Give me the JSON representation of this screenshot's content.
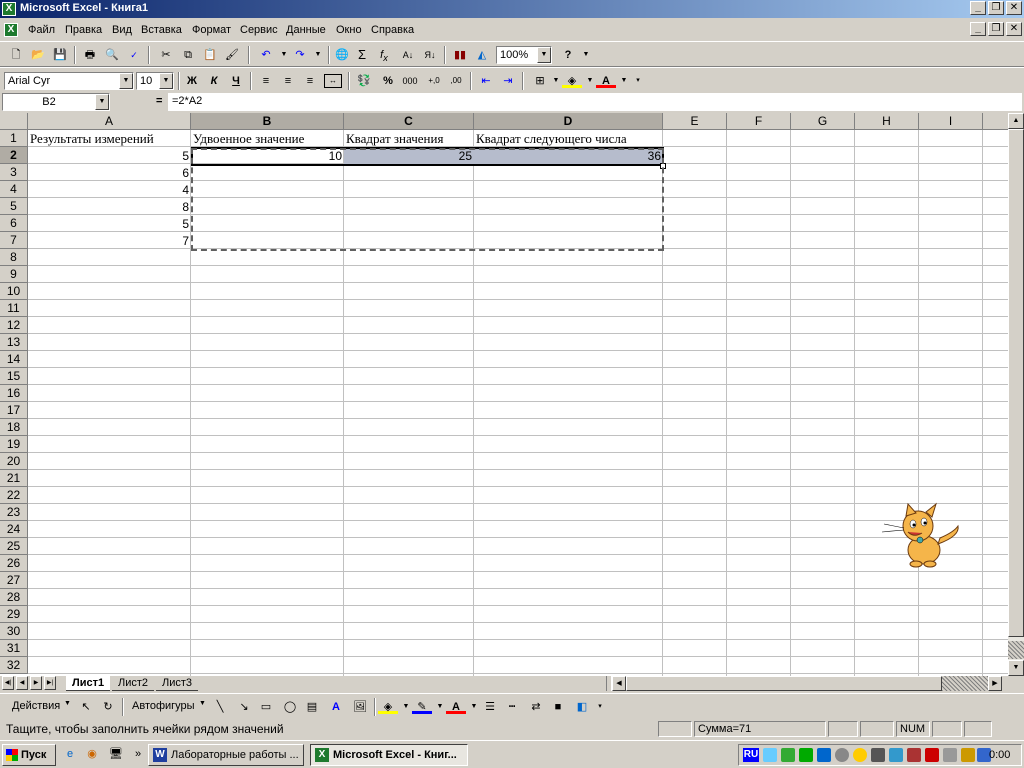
{
  "window": {
    "title": "Microsoft Excel - Книга1"
  },
  "menu": [
    "Файл",
    "Правка",
    "Вид",
    "Вставка",
    "Формат",
    "Сервис",
    "Данные",
    "Окно",
    "Справка"
  ],
  "toolbar": {
    "zoom": "100%",
    "font": "Arial Cyr",
    "size": "10"
  },
  "formula_bar": {
    "name_box": "B2",
    "equals": "=",
    "formula": "=2*A2"
  },
  "columns": [
    "A",
    "B",
    "C",
    "D",
    "E",
    "F",
    "G",
    "H",
    "I"
  ],
  "rows": [
    "1",
    "2",
    "3",
    "4",
    "5",
    "6",
    "7",
    "8",
    "9",
    "10",
    "11",
    "12",
    "13",
    "14",
    "15",
    "16",
    "17",
    "18",
    "19",
    "20",
    "21",
    "22",
    "23",
    "24",
    "25",
    "26",
    "27",
    "28",
    "29",
    "30",
    "31",
    "32"
  ],
  "cells": {
    "A1": "Результаты измерений",
    "B1": "Удвоенное значение",
    "C1": "Квадрат значения",
    "D1": "Квадрат следующего числа",
    "A2": "5",
    "A3": "6",
    "A4": "4",
    "A5": "8",
    "A6": "5",
    "A7": "7",
    "B2": "10",
    "C2": "25",
    "D2": "36"
  },
  "sheets": [
    "Лист1",
    "Лист2",
    "Лист3"
  ],
  "drawing": {
    "actions": "Действия",
    "autoshapes": "Автофигуры"
  },
  "status": {
    "message": "Тащите, чтобы заполнить ячейки рядом значений",
    "sum": "Сумма=71",
    "num": "NUM"
  },
  "taskbar": {
    "start": "Пуск",
    "tasks": [
      "Лабораторные работы ...",
      "Microsoft Excel - Книг..."
    ],
    "lang": "RU",
    "clock": "0:00"
  }
}
